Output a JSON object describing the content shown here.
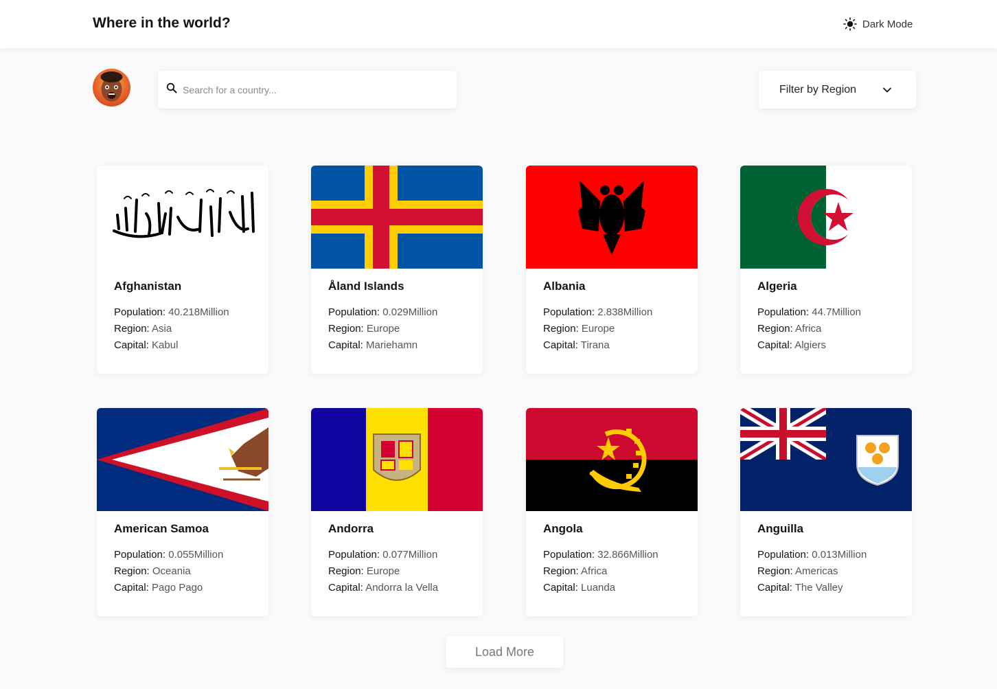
{
  "header": {
    "title": "Where in the world?",
    "theme_toggle": {
      "label": "Dark Mode",
      "icon": "sun-icon"
    }
  },
  "toolbar": {
    "search": {
      "placeholder": "Search for a country...",
      "value": "",
      "icon": "search-icon"
    },
    "filter": {
      "label": "Filter by Region",
      "icon": "chevron-down-icon"
    }
  },
  "labels": {
    "population": "Population:",
    "region": "Region:",
    "capital": "Capital:"
  },
  "countries": [
    {
      "name": "Afghanistan",
      "population": "40.218Million",
      "region": "Asia",
      "capital": "Kabul",
      "flag": "afghanistan-flag"
    },
    {
      "name": "Åland Islands",
      "population": "0.029Million",
      "region": "Europe",
      "capital": "Mariehamn",
      "flag": "aland-islands-flag"
    },
    {
      "name": "Albania",
      "population": "2.838Million",
      "region": "Europe",
      "capital": "Tirana",
      "flag": "albania-flag"
    },
    {
      "name": "Algeria",
      "population": "44.7Million",
      "region": "Africa",
      "capital": "Algiers",
      "flag": "algeria-flag"
    },
    {
      "name": "American Samoa",
      "population": "0.055Million",
      "region": "Oceania",
      "capital": "Pago Pago",
      "flag": "american-samoa-flag"
    },
    {
      "name": "Andorra",
      "population": "0.077Million",
      "region": "Europe",
      "capital": "Andorra la Vella",
      "flag": "andorra-flag"
    },
    {
      "name": "Angola",
      "population": "32.866Million",
      "region": "Africa",
      "capital": "Luanda",
      "flag": "angola-flag"
    },
    {
      "name": "Anguilla",
      "population": "0.013Million",
      "region": "Americas",
      "capital": "The Valley",
      "flag": "anguilla-flag"
    }
  ],
  "load_more": {
    "label": "Load More"
  },
  "colors": {
    "background": "#fafafa",
    "surface": "#ffffff",
    "text": "#111517"
  }
}
